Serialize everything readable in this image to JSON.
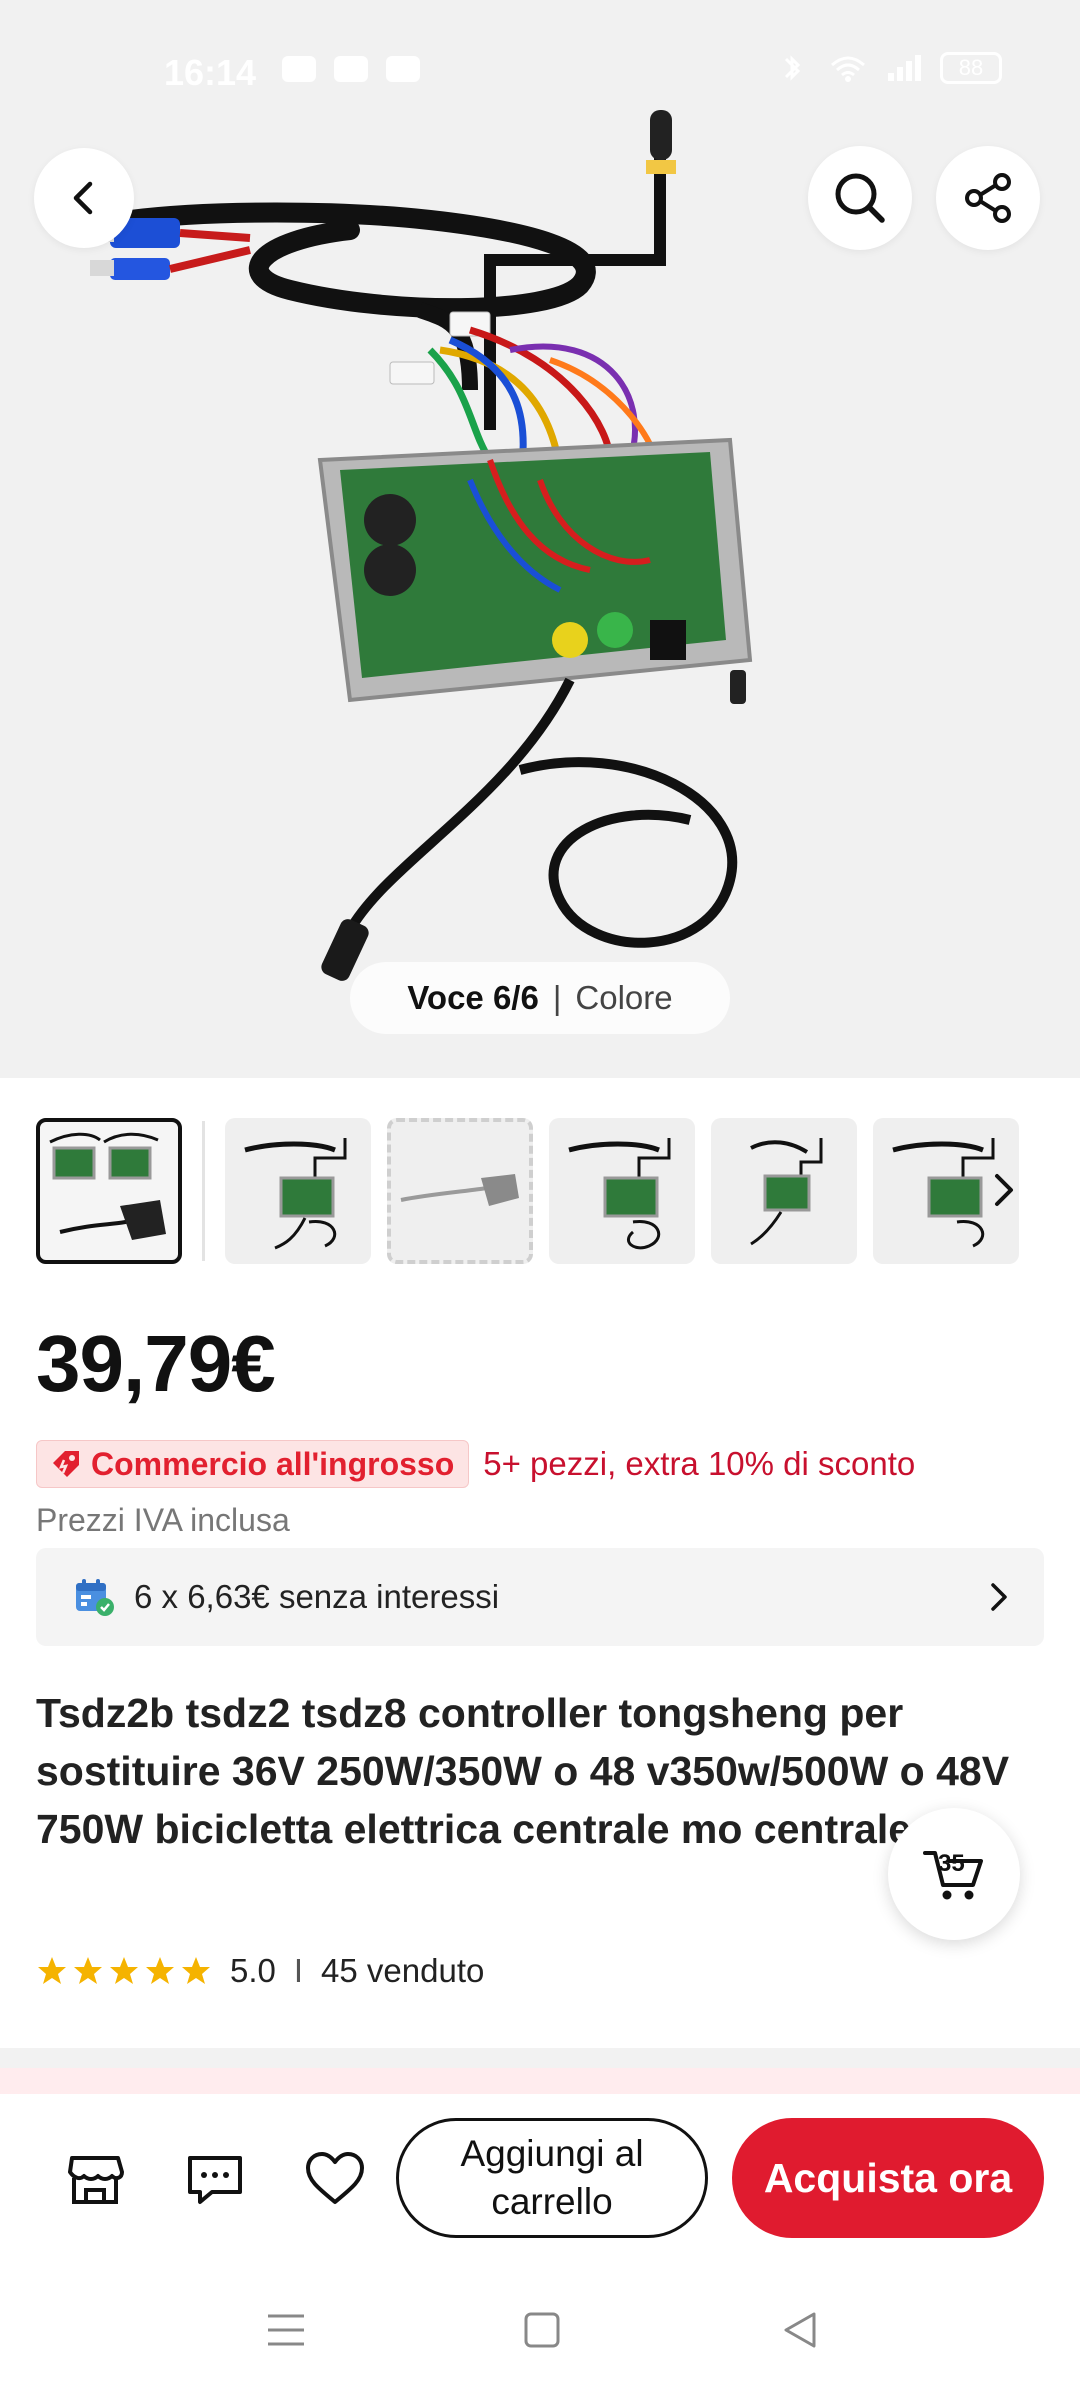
{
  "status_bar": {
    "time": "16:14",
    "battery": "88"
  },
  "gallery": {
    "counter_label": "Voce 6/6",
    "separator": "|",
    "variant_label": "Colore",
    "thumbnail_count": 6,
    "selected_index": 0
  },
  "product": {
    "price": "39,79€",
    "wholesale_badge": "Commercio all'ingrosso",
    "wholesale_offer": "5+ pezzi, extra 10% di sconto",
    "vat_note": "Prezzi IVA inclusa",
    "installment": "6 x 6,63€ senza interessi",
    "title": "Tsdz2b tsdz2 tsdz8 controller tongsheng per sostituire 36V 250W/350W o 48 v350w/500W o 48V 750W bicicletta elettrica centrale mo centrale",
    "rating": "5.0",
    "rating_separator": "I",
    "sold": "45 venduto",
    "stars": 5
  },
  "cart_fab": {
    "count": "35"
  },
  "actions": {
    "add_to_cart": "Aggiungi al carrello",
    "buy_now": "Acquista ora"
  },
  "colors": {
    "accent_red": "#e01b2f",
    "promo_red": "#c8102e",
    "star_yellow": "#f5b300",
    "background_gray": "#f1f1f1"
  },
  "icons": {
    "back": "chevron-left-icon",
    "search": "search-icon",
    "share": "share-icon",
    "thumbs_next": "chevron-right-icon",
    "installment": "calendar-icon",
    "installment_next": "chevron-right-icon",
    "store": "store-icon",
    "chat": "chat-icon",
    "wishlist": "heart-icon",
    "cart": "cart-icon"
  }
}
